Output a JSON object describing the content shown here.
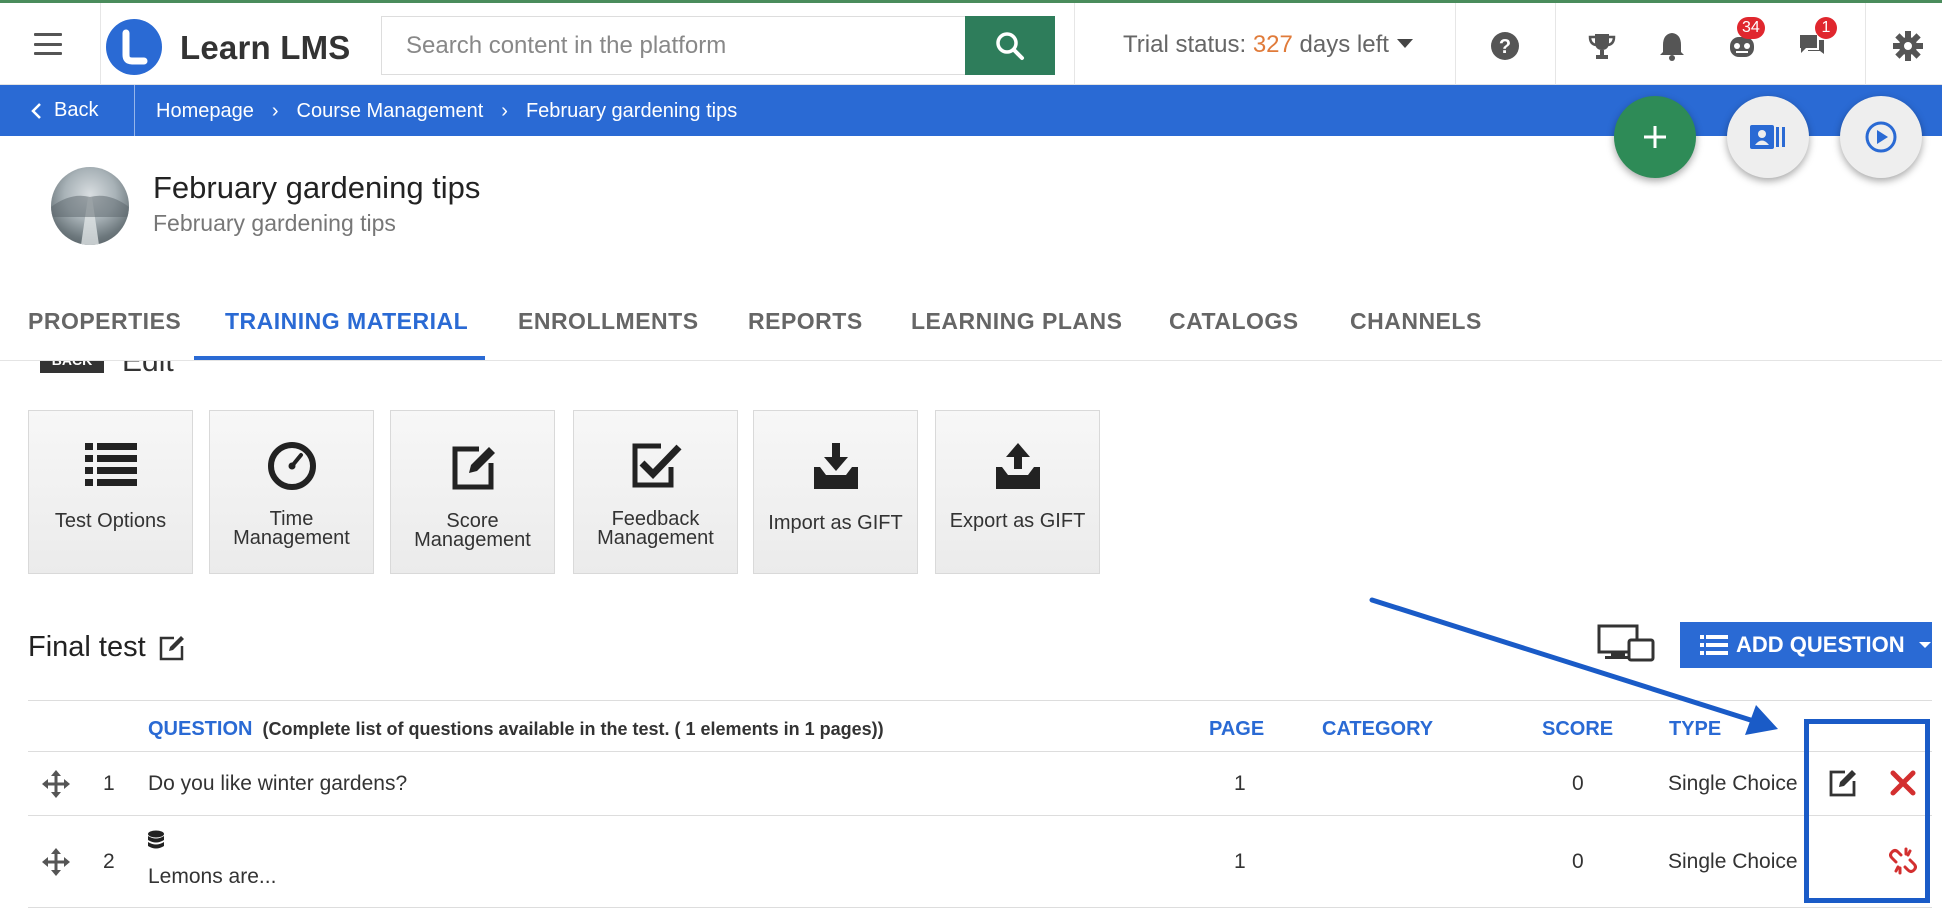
{
  "header": {
    "app_name": "Learn LMS",
    "search_placeholder": "Search content in the platform",
    "trial_prefix": "Trial status: ",
    "trial_days": "327",
    "trial_suffix": " days left",
    "robot_badge": "34",
    "chat_badge": "1",
    "icons": [
      "menu-icon",
      "search-icon",
      "help-icon",
      "trophy-icon",
      "bell-icon",
      "robot-icon",
      "chat-icon",
      "gear-icon"
    ]
  },
  "breadcrumb": {
    "back_label": "Back",
    "items": [
      "Homepage",
      "Course Management",
      "February gardening tips"
    ]
  },
  "course": {
    "title": "February gardening tips",
    "subtitle": "February gardening tips"
  },
  "tabs": [
    "PROPERTIES",
    "TRAINING MATERIAL",
    "ENROLLMENTS",
    "REPORTS",
    "LEARNING PLANS",
    "CATALOGS",
    "CHANNELS"
  ],
  "active_tab": "TRAINING MATERIAL",
  "edit_bar": {
    "back_label": "BACK",
    "title": "Edit"
  },
  "cards": [
    {
      "line1": "Test Options",
      "line2": "",
      "icon": "list-icon"
    },
    {
      "line1": "Time",
      "line2": "Management",
      "icon": "clock-icon"
    },
    {
      "line1": "Score",
      "line2": "Management",
      "icon": "edit-icon"
    },
    {
      "line1": "Feedback",
      "line2": "Management",
      "icon": "check-square-icon"
    },
    {
      "line1": "Import as GIFT",
      "line2": "",
      "icon": "import-icon"
    },
    {
      "line1": "Export as GIFT",
      "line2": "",
      "icon": "export-icon"
    }
  ],
  "test": {
    "title": "Final test",
    "add_question_label": "ADD QUESTION"
  },
  "table": {
    "headers": {
      "question": "QUESTION",
      "question_note": "(Complete list of questions available in the test. ( 1 elements in 1 pages))",
      "page": "PAGE",
      "category": "CATEGORY",
      "score": "SCORE",
      "type": "TYPE"
    },
    "rows": [
      {
        "num": "1",
        "question": "Do you like winter gardens?",
        "page": "1",
        "category": "",
        "score": "0",
        "type": "Single Choice"
      },
      {
        "num": "2",
        "question": "Lemons are...",
        "page": "1",
        "category": "",
        "score": "0",
        "type": "Single Choice"
      }
    ]
  },
  "colors": {
    "primary_blue": "#2a6ad4",
    "green": "#2e7d5b",
    "trial_orange": "#e07b3a",
    "badge_red": "#e0272e",
    "delete_red": "#d32f2f"
  }
}
